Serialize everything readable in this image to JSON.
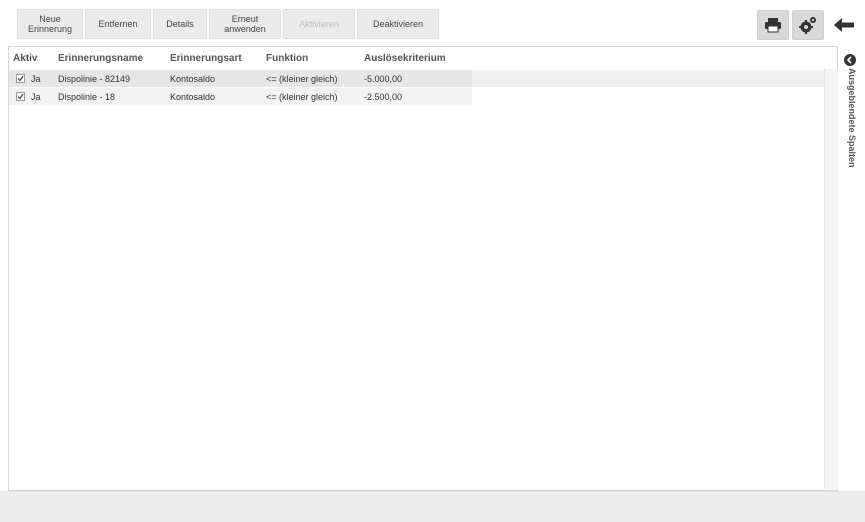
{
  "toolbar": {
    "buttons": [
      {
        "label": "Neue\nErinnerung"
      },
      {
        "label": "Entfernen"
      },
      {
        "label": "Details"
      },
      {
        "label": "Erneut\nanwenden"
      },
      {
        "label": "Aktivieren"
      },
      {
        "label": "Deaktivieren"
      }
    ],
    "icons": [
      "printer-icon",
      "settings-icon",
      "back-arrow-icon"
    ]
  },
  "table": {
    "columns": [
      "Aktiv",
      "Erinnerungsname",
      "Erinnerungsart",
      "Funktion",
      "Auslösekriterium"
    ],
    "rows": [
      {
        "active": "Ja",
        "name": "Dispolinie - 82149",
        "type": "Kontosaldo",
        "function": "<= (kleiner gleich)",
        "criterion": "-5.000,00"
      },
      {
        "active": "Ja",
        "name": "Dispolinie - 18",
        "type": "Kontosaldo",
        "function": "<= (kleiner gleich)",
        "criterion": "-2.500,00"
      }
    ]
  },
  "side_panel": {
    "label": "Ausgeblendete Spalten"
  },
  "colors": {
    "button_bg": "#ebebeb",
    "icon_button_bg": "#d9d9d9",
    "row_bg": "#ececec",
    "footer_bg": "#eeeeee"
  }
}
